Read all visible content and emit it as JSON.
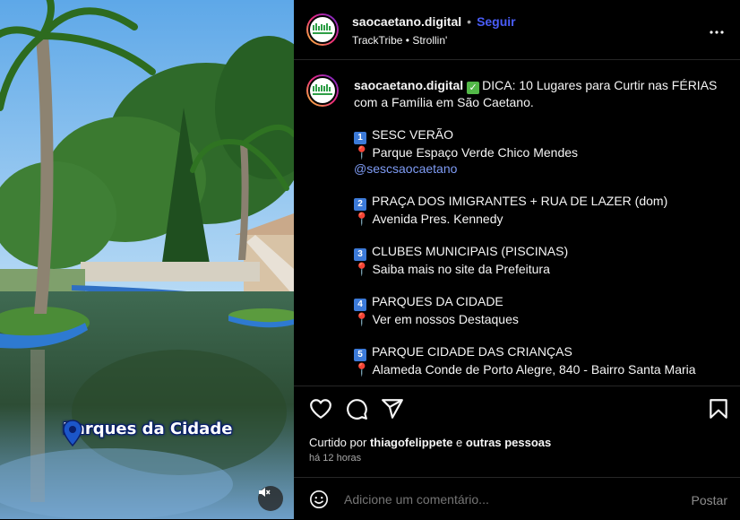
{
  "media": {
    "overlay_label": "Parques da Cidade",
    "mute_icon": "speaker-muted-icon"
  },
  "header": {
    "username": "saocaetano.digital",
    "separator": "•",
    "follow_label": "Seguir",
    "audio": "TrackTribe • Strollin'",
    "more_icon": "more-options-icon"
  },
  "caption": {
    "username": "saocaetano.digital",
    "intro_prefix": "",
    "intro_text": "DICA: 10 Lugares para Curtir nas FÉRIAS com a Família em São Caetano.",
    "items": [
      {
        "num": "1",
        "title": "SESC VERÃO",
        "location": "Parque Espaço Verde Chico Mendes",
        "mention": "@sescsaocaetano"
      },
      {
        "num": "2",
        "title": "PRAÇA DOS IMIGRANTES + RUA DE LAZER (dom)",
        "location": "Avenida Pres. Kennedy"
      },
      {
        "num": "3",
        "title": "CLUBES MUNICIPAIS (PISCINAS)",
        "location": "Saiba mais no site da Prefeitura"
      },
      {
        "num": "4",
        "title": "PARQUES DA CIDADE",
        "location": "Ver em nossos Destaques"
      },
      {
        "num": "5",
        "title": "PARQUE CIDADE DAS CRIANÇAS",
        "location": "Alameda Conde de Porto Alegre, 840 - Bairro Santa Maria"
      }
    ]
  },
  "actions": {
    "like_icon": "heart-icon",
    "comment_icon": "comment-icon",
    "share_icon": "share-icon",
    "save_icon": "bookmark-icon"
  },
  "likes": {
    "prefix": "Curtido por",
    "user": "thiagofelippete",
    "joiner": "e",
    "others": "outras pessoas"
  },
  "time": "há 12 horas",
  "comment": {
    "placeholder": "Adicione um comentário...",
    "post_label": "Postar",
    "emoji_icon": "emoji-icon"
  },
  "colors": {
    "follow": "#4a5df9",
    "mention": "#7f9cf5",
    "background": "#000000",
    "divider": "#262626"
  }
}
